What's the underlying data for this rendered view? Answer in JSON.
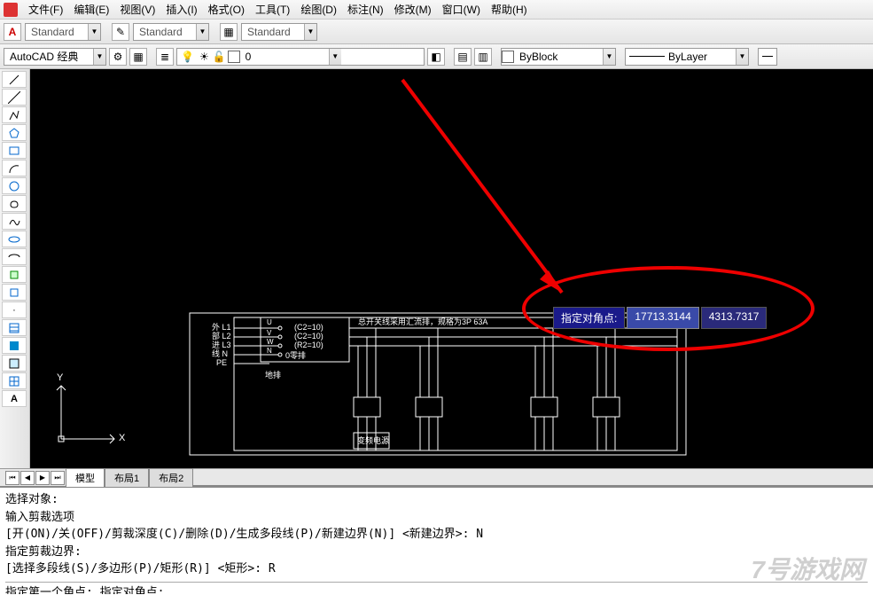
{
  "menu": {
    "items": [
      "文件(F)",
      "编辑(E)",
      "视图(V)",
      "插入(I)",
      "格式(O)",
      "工具(T)",
      "绘图(D)",
      "标注(N)",
      "修改(M)",
      "窗口(W)",
      "帮助(H)"
    ]
  },
  "style_bar": {
    "text_style": "Standard",
    "dim_style": "Standard",
    "table_style": "Standard"
  },
  "workspace_bar": {
    "workspace": "AutoCAD 经典",
    "layer": "0",
    "color_control": "ByBlock",
    "linetype": "ByLayer"
  },
  "tooltip": {
    "label": "指定对角点:",
    "x": "17713.3144",
    "y": "4313.7317"
  },
  "drawing_text": {
    "note": "总开关线采用汇流排，规格为3P 63A",
    "row1": "外 L1",
    "row2": "部 L2",
    "row3": "进 L3",
    "row4": "线 N",
    "row5": "PE",
    "c1": "(C2=10)",
    "c2": "(C2=10)",
    "c3": "(R2=10)",
    "zero": "0零排",
    "ground": "地排",
    "label_inverter": "变频电源"
  },
  "axis": {
    "x": "X",
    "y": "Y"
  },
  "tabs": {
    "model": "模型",
    "layout1": "布局1",
    "layout2": "布局2"
  },
  "command": {
    "l1": "选择对象:",
    "l2": "输入剪裁选项",
    "l3": "[开(ON)/关(OFF)/剪裁深度(C)/删除(D)/生成多段线(P)/新建边界(N)] <新建边界>: N",
    "l4": "指定剪裁边界:",
    "l5": "[选择多段线(S)/多边形(P)/矩形(R)] <矩形>: R",
    "l6": "指定第一个角点: 指定对角点:"
  },
  "watermark": "7号游戏网"
}
